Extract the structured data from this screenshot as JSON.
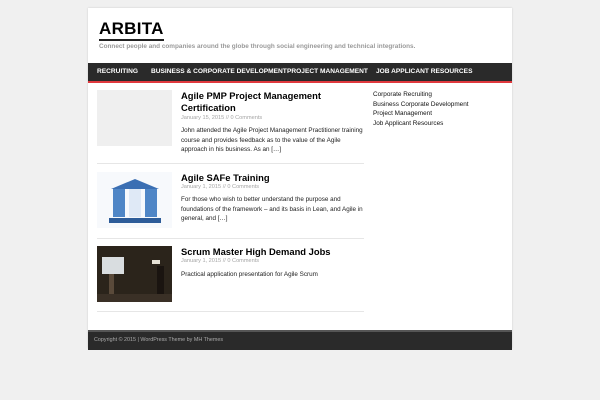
{
  "site": {
    "title": "ARBITA",
    "tagline": "Connect people and companies around the globe through social engineering and technical integrations."
  },
  "nav": {
    "items": [
      {
        "label": "RECRUITING"
      },
      {
        "label": "BUSINESS & CORPORATE DEVELOPMENT"
      },
      {
        "label": "PROJECT MANAGEMENT"
      },
      {
        "label": "JOB APPLICANT RESOURCES"
      }
    ]
  },
  "posts": [
    {
      "title": "Agile PMP Project Management Certification",
      "date": "January 15, 2015",
      "separator": "//",
      "comments": "0 Comments",
      "excerpt": "John attended the Agile Project Management Practitioner training course and provides feedback as to the value of the Agile approach in his business. As an […]"
    },
    {
      "title": "Agile SAFe Training",
      "date": "January 1, 2015",
      "separator": "//",
      "comments": "0 Comments",
      "excerpt": "For those who wish to better understand the purpose and foundations of the framework – and its basis in Lean, and Agile in general, and […]"
    },
    {
      "title": "Scrum Master High Demand Jobs",
      "date": "January 1, 2015",
      "separator": "//",
      "comments": "0 Comments",
      "excerpt": "Practical application presentation for Agile Scrum"
    }
  ],
  "sidebar": {
    "items": [
      {
        "label": "Corporate Recruiting"
      },
      {
        "label": "Business Corporate Development"
      },
      {
        "label": "Project Management"
      },
      {
        "label": "Job Applicant Resources"
      }
    ]
  },
  "footer": {
    "text": "Copyright © 2015 | WordPress Theme by MH Themes"
  },
  "colors": {
    "nav_background": "#2a2a2a",
    "nav_accent": "#e0393e",
    "footer_background": "#2a2a2a"
  }
}
